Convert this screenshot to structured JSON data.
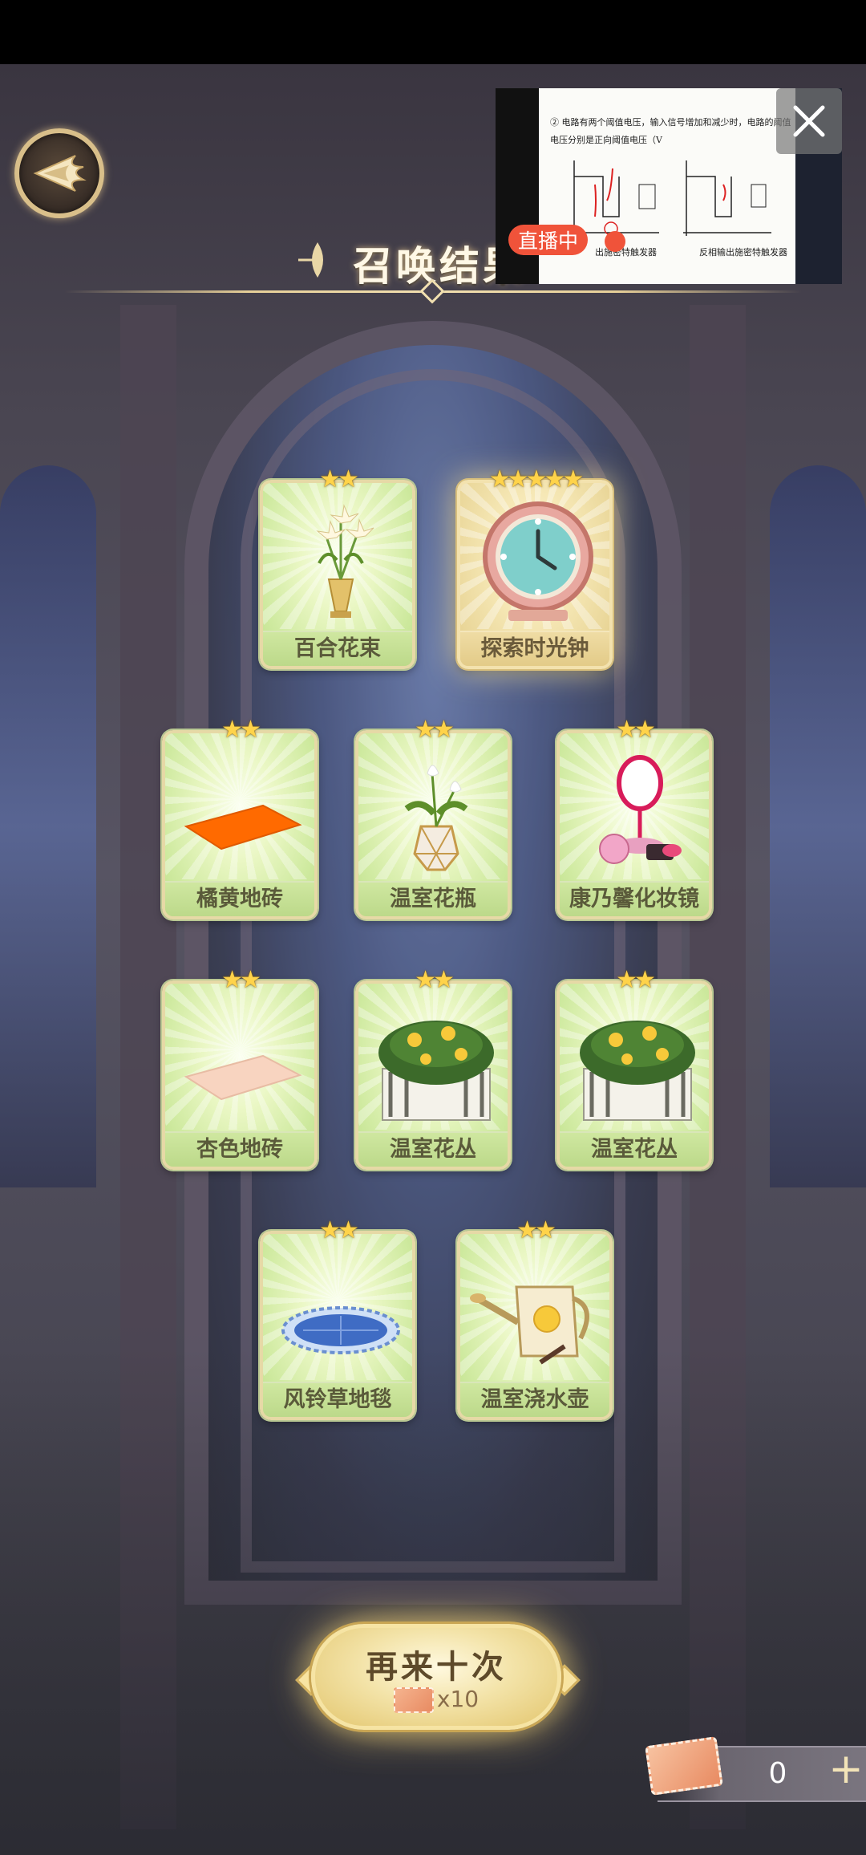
{
  "header": {
    "title": "召唤结果"
  },
  "live_overlay": {
    "badge": "直播中",
    "slide_lines": [
      "② 电路有两个阈值电压，输入信号增加和减少时，电路的阈值",
      "电压分别是正向阈值电压（V",
      "出施密特触发器",
      "反相输出施密特触发器"
    ]
  },
  "cards": [
    {
      "name": "百合花束",
      "stars": 2,
      "rarity": "normal"
    },
    {
      "name": "探索时光钟",
      "stars": 5,
      "rarity": "gold"
    },
    {
      "name": "橘黄地砖",
      "stars": 2,
      "rarity": "normal"
    },
    {
      "name": "温室花瓶",
      "stars": 2,
      "rarity": "normal"
    },
    {
      "name": "康乃馨化妆镜",
      "stars": 2,
      "rarity": "normal"
    },
    {
      "name": "杏色地砖",
      "stars": 2,
      "rarity": "normal"
    },
    {
      "name": "温室花丛",
      "stars": 2,
      "rarity": "normal"
    },
    {
      "name": "温室花丛",
      "stars": 2,
      "rarity": "normal"
    },
    {
      "name": "风铃草地毯",
      "stars": 2,
      "rarity": "normal"
    },
    {
      "name": "温室浇水壶",
      "stars": 2,
      "rarity": "normal"
    }
  ],
  "summon_again": {
    "label": "再来十次",
    "cost": "x10"
  },
  "currency": {
    "count": "0",
    "add_label": "+"
  },
  "colors": {
    "card_green": "#cfeaa0",
    "card_gold": "#ead79a",
    "star": "#ffd34a",
    "live_red": "#f0533a"
  }
}
